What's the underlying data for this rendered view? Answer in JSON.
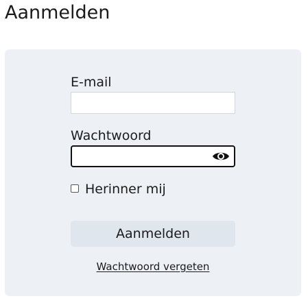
{
  "page": {
    "title": "Aanmelden"
  },
  "form": {
    "email": {
      "label": "E-mail",
      "value": "",
      "placeholder": ""
    },
    "password": {
      "label": "Wachtwoord",
      "value": "",
      "placeholder": "",
      "toggle_icon": "eye-icon"
    },
    "remember": {
      "label": "Herinner mij",
      "checked": false
    },
    "submit_label": "Aanmelden",
    "forgot_label": "Wachtwoord vergeten"
  },
  "colors": {
    "panel_background": "#edf1f5",
    "button_background": "#e0e6ee",
    "text": "#1b1b1b",
    "focus_border": "#111111"
  }
}
